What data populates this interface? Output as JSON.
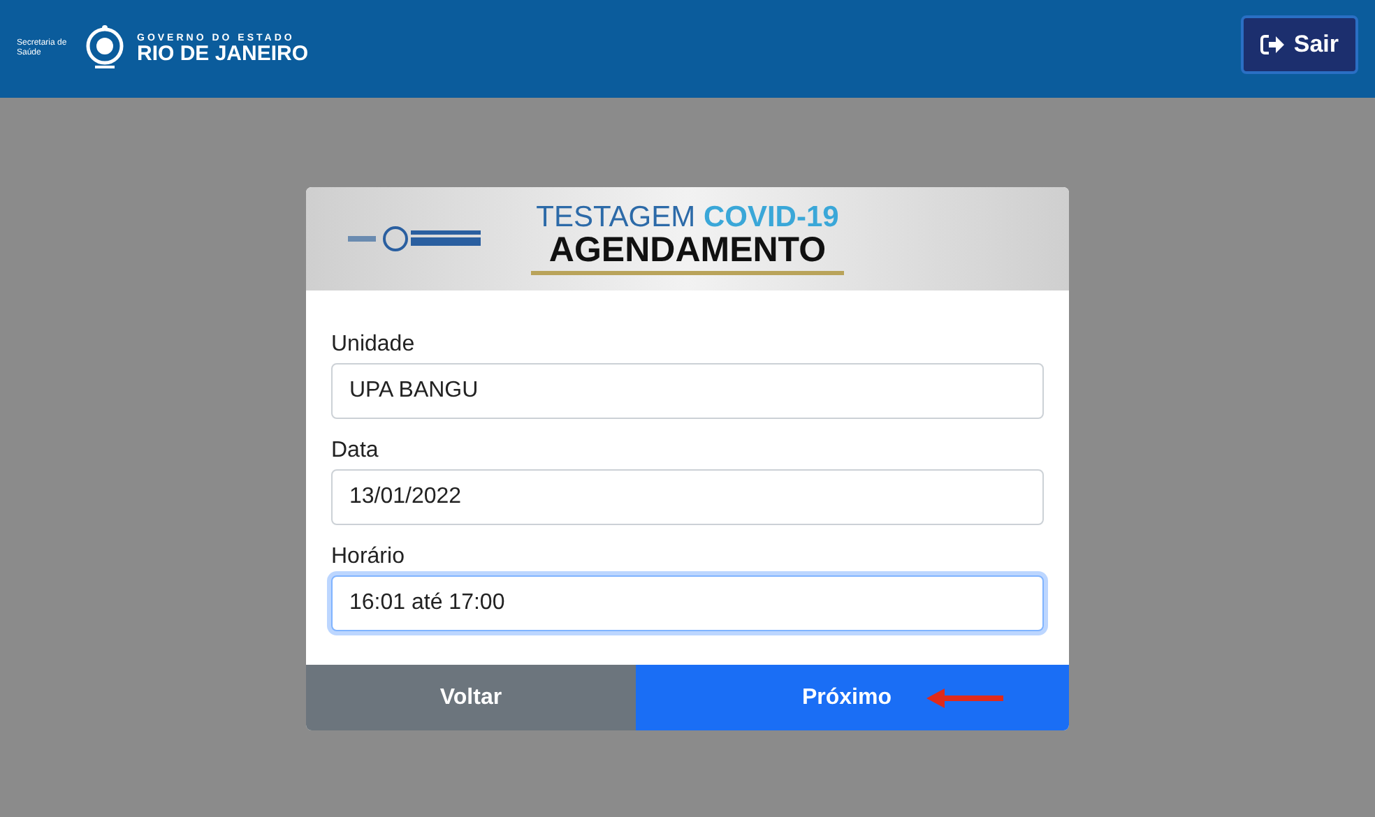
{
  "header": {
    "secretaria": "Secretaria de Saúde",
    "gov_line": "GOVERNO DO ESTADO",
    "state_name": "RIO DE JANEIRO",
    "logout_button": "Sair"
  },
  "banner": {
    "title_start": "TESTAGEM",
    "title_highlight": "COVID-19",
    "subtitle": "AGENDAMENTO"
  },
  "fields": [
    {
      "label": "Unidade",
      "value": "UPA BANGU",
      "focused": false
    },
    {
      "label": "Data",
      "value": "13/01/2022",
      "focused": false
    },
    {
      "label": "Horário",
      "value": "16:01 até 17:00",
      "focused": true
    }
  ],
  "buttons": [
    {
      "label": "Voltar",
      "kind": "secondary"
    },
    {
      "label": "Próximo",
      "kind": "primary"
    }
  ]
}
